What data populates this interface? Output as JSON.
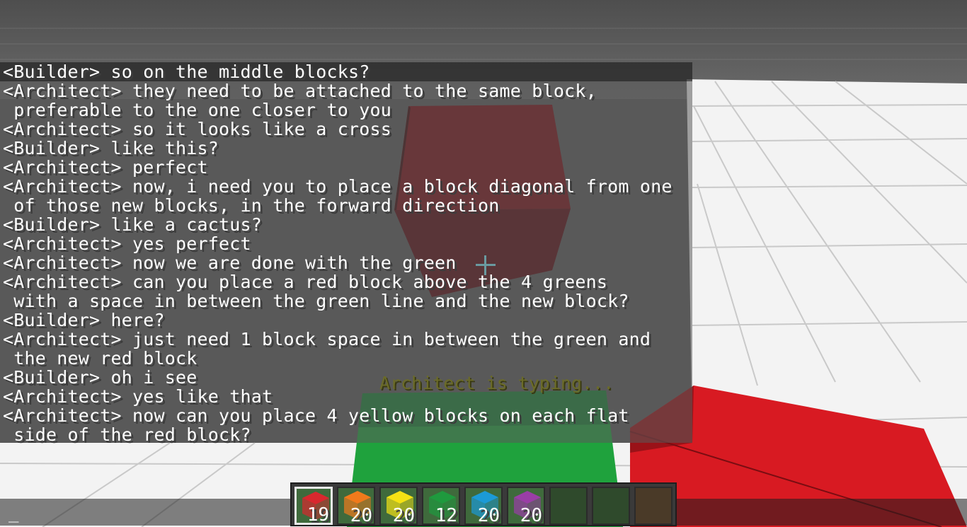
{
  "chat": {
    "lines": [
      "<Builder> so on the middle blocks?",
      "<Architect> they need to be attached to the same block,",
      " preferable to the one closer to you",
      "<Architect> so it looks like a cross",
      "<Builder> like this?",
      "<Architect> perfect",
      "<Architect> now, i need you to place a block diagonal from one",
      " of those new blocks, in the forward direction",
      "<Builder> like a cactus?",
      "<Architect> yes perfect",
      "<Architect> now we are done with the green",
      "<Architect> can you place a red block above the 4 greens",
      " with a space in between the green line and the new block?",
      "<Builder> here?",
      "<Architect> just need 1 block space in between the green and",
      " the new red block",
      "<Builder> oh i see",
      "<Architect> yes like that",
      "<Architect> now can you place 4 yellow blocks on each flat",
      " side of the red block?"
    ],
    "typing_indicator": "Architect is typing...",
    "input_cursor": "_"
  },
  "hotbar": {
    "slots": [
      {
        "color_name": "red",
        "color": "#d8282e",
        "count": "19",
        "selected": true
      },
      {
        "color_name": "orange",
        "color": "#f07a1c",
        "count": "20",
        "selected": false
      },
      {
        "color_name": "yellow",
        "color": "#f5e214",
        "count": "20",
        "selected": false
      },
      {
        "color_name": "green",
        "color": "#1f9a3e",
        "count": "12",
        "selected": false
      },
      {
        "color_name": "blue",
        "color": "#1c9ad6",
        "count": "20",
        "selected": false
      },
      {
        "color_name": "purple",
        "color": "#9a3ea6",
        "count": "20",
        "selected": false
      },
      {
        "color_name": "empty",
        "color": "",
        "count": "",
        "selected": false
      },
      {
        "color_name": "empty",
        "color": "",
        "count": "",
        "selected": false
      },
      {
        "color_name": "empty",
        "color": "",
        "count": "",
        "selected": false
      }
    ]
  },
  "world": {
    "sky_color": "#5c5c5c",
    "floor_color": "#f2f2f2",
    "grid_color": "#c8c8c8",
    "blocks": [
      "red block (floating)",
      "green block (ground)",
      "red block (ground, right)"
    ]
  }
}
